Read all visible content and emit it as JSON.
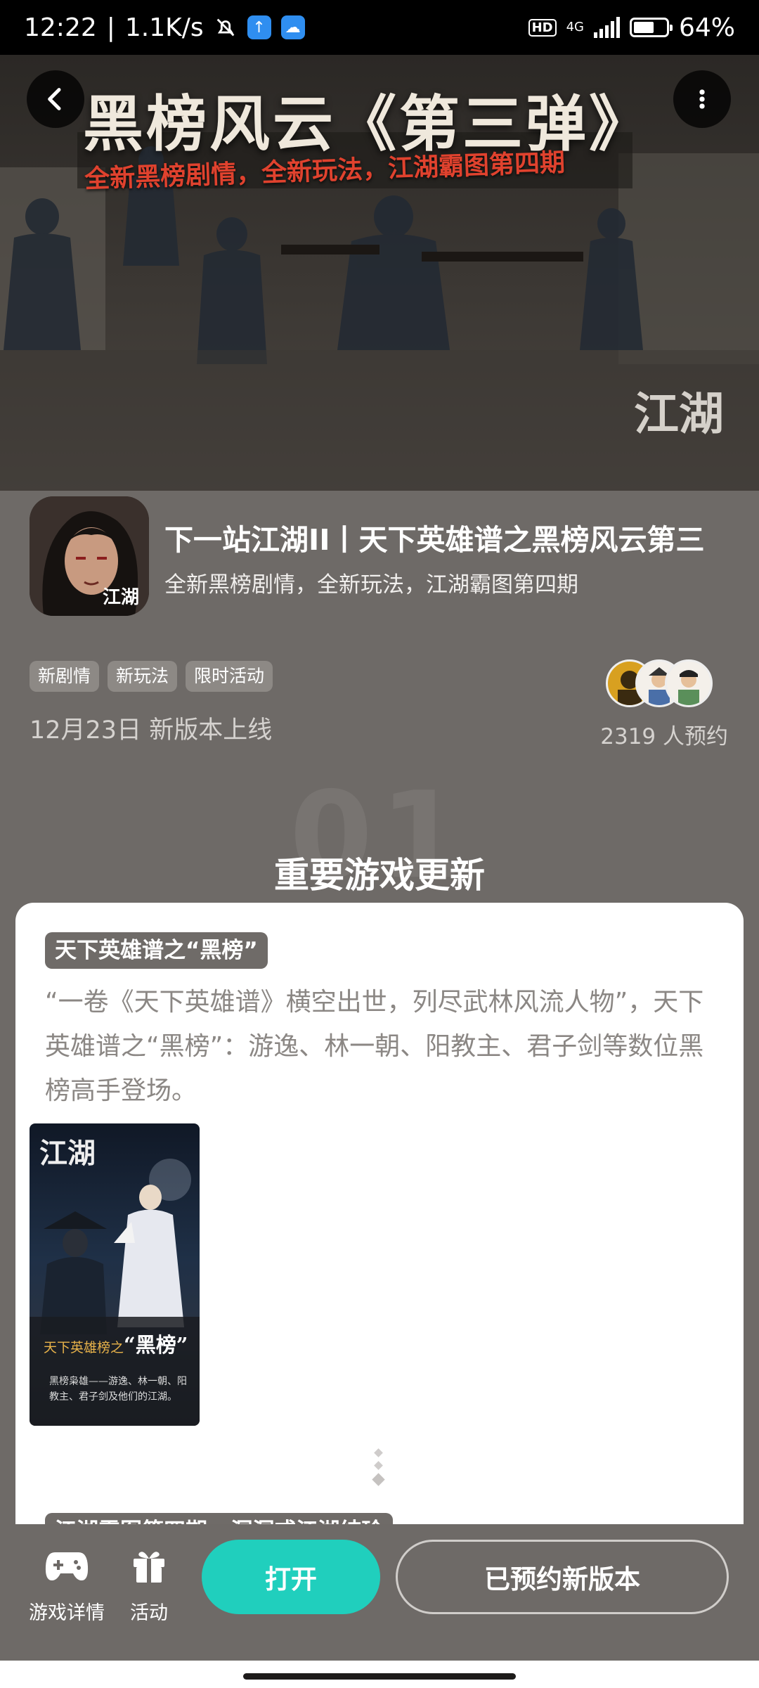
{
  "status_bar": {
    "time": "12:22",
    "net_speed": "1.1K/s",
    "hd": "HD",
    "network": "4G",
    "battery_percent": "64%",
    "battery_level": 0.64
  },
  "hero": {
    "title": "黑榜风云《第三弹》",
    "subtitle": "全新黑榜剧情，全新玩法，江湖霸图第四期",
    "logo_text": "江湖"
  },
  "app": {
    "name": "下一站江湖II丨天下英雄谱之黑榜风云第三",
    "desc": "全新黑榜剧情，全新玩法，江湖霸图第四期",
    "icon_text": "江湖",
    "tags": [
      "新剧情",
      "新玩法",
      "限时活动"
    ],
    "release_text": "12月23日 新版本上线",
    "reserve_count": "2319 人预约"
  },
  "section": {
    "number": "01",
    "title": "重要游戏更新"
  },
  "card": {
    "label": "天下英雄谱之“黑榜”",
    "body": "“一卷《天下英雄谱》横空出世，列尽武林风流人物”，天下英雄谱之“黑榜”：游逸、林一朝、阳教主、君子剑等数位黑榜高手登场。",
    "poster": {
      "logo": "江湖",
      "title_prefix": "天下英雄榜之",
      "title_main": "“黑榜”",
      "text": "黑榜枭雄——游逸、林一朝、阳教主、君子剑及他们的江湖。"
    },
    "next_label": "江湖霸图第四期 · 洞洞或江湖结珍"
  },
  "bottom_bar": {
    "game_detail_label": "游戏详情",
    "activity_label": "活动",
    "open_label": "打开",
    "reserved_label": "已预约新版本"
  },
  "icons": {
    "back": "back-arrow-icon",
    "more": "more-vertical-icon",
    "game_detail": "gamepad-icon",
    "activity": "gift-icon"
  },
  "colors": {
    "background": "#6e6a67",
    "accent": "#20cfbd",
    "hero_subtitle": "#e0422e"
  }
}
